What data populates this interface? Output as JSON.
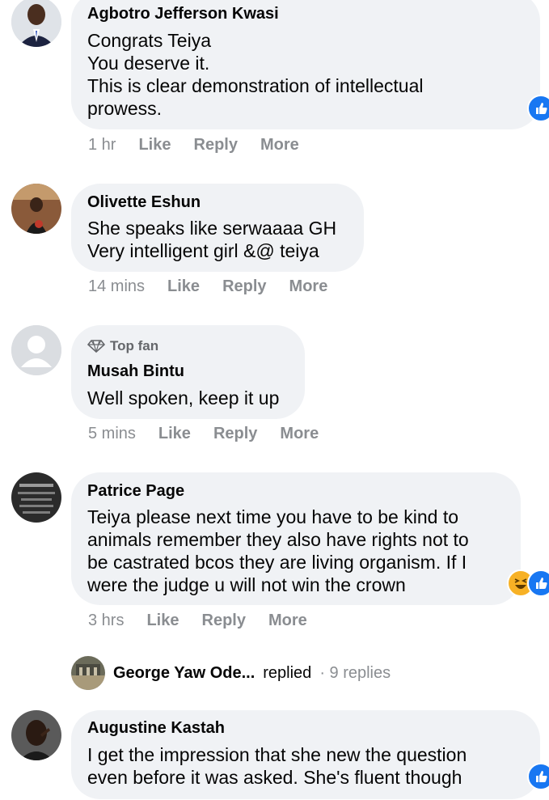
{
  "comments": [
    {
      "name": "Agbotro Jefferson Kwasi",
      "text": "Congrats Teiya\nYou deserve it.\nThis is clear demonstration of intellectual\nprowess.",
      "time": "1 hr",
      "like": "Like",
      "reply": "Reply",
      "more": "More",
      "reaction_icon": "like-reaction-icon"
    },
    {
      "name": "Olivette Eshun",
      "text": "She speaks like serwaaaa GH\nVery intelligent girl &@ teiya",
      "time": "14 mins",
      "like": "Like",
      "reply": "Reply",
      "more": "More"
    },
    {
      "badge": "Top fan",
      "name": "Musah Bintu",
      "text": "Well spoken, keep it up",
      "time": "5 mins",
      "like": "Like",
      "reply": "Reply",
      "more": "More"
    },
    {
      "name": "Patrice Page",
      "text": "Teiya please next time you have to be kind to\nanimals remember they also have rights not to\nbe castrated bcos they are living organism. If I\nwere the judge u will not win the crown",
      "time": "3 hrs",
      "like": "Like",
      "reply": "Reply",
      "more": "More",
      "reaction_icons": [
        "haha-reaction-icon",
        "like-reaction-icon"
      ]
    },
    {
      "name": "Augustine Kastah",
      "text": "I get the impression that she new the question\neven before it was asked. She's fluent though",
      "reaction_icon": "like-reaction-icon"
    }
  ],
  "reply_thread": {
    "name": "George Yaw Ode...",
    "replied": "replied",
    "count": "· 9 replies"
  },
  "colors": {
    "bubble": "#f0f2f5",
    "meta": "#8a8d91",
    "like_blue": "#1877f2",
    "haha_yellow": "#f7b125"
  }
}
